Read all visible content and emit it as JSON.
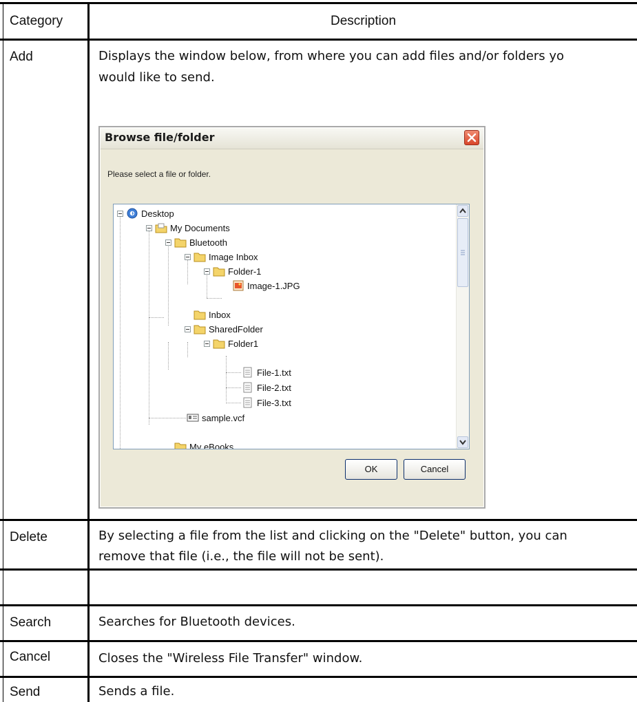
{
  "table": {
    "header": {
      "category": "Category",
      "description": "Description"
    },
    "rows": [
      {
        "category": "Add",
        "description_lines": [
          "Displays the window below, from where you can add files and/or folders yo",
          "would like to send."
        ]
      },
      {
        "category": "Delete",
        "description_lines": [
          "By selecting a file from the list and clicking on the \"Delete\" button, you can",
          "remove that file (i.e., the file will not be sent)."
        ]
      },
      {
        "category": "Search",
        "description": "Searches for Bluetooth devices."
      },
      {
        "category": "Cancel",
        "description": "Closes the \"Wireless File Transfer\" window."
      },
      {
        "category": "Send",
        "description": "Sends a file."
      }
    ]
  },
  "dialog": {
    "title": "Browse file/folder",
    "prompt": "Please select a file or folder.",
    "tree": [
      {
        "label": "Desktop",
        "icon": "desktop-icon"
      },
      {
        "label": "My Documents",
        "icon": "my-documents-folder-icon"
      },
      {
        "label": "Bluetooth",
        "icon": "folder-icon"
      },
      {
        "label": "Image Inbox",
        "icon": "folder-icon"
      },
      {
        "label": "Folder-1",
        "icon": "folder-icon"
      },
      {
        "label": "Image-1.JPG",
        "icon": "image-file-icon"
      },
      {
        "label": "Inbox",
        "icon": "folder-icon"
      },
      {
        "label": "SharedFolder",
        "icon": "folder-icon"
      },
      {
        "label": "Folder1",
        "icon": "folder-icon"
      },
      {
        "label": "File-1.txt",
        "icon": "text-file-icon"
      },
      {
        "label": "File-2.txt",
        "icon": "text-file-icon"
      },
      {
        "label": "File-3.txt",
        "icon": "text-file-icon"
      },
      {
        "label": "sample.vcf",
        "icon": "vcard-file-icon"
      },
      {
        "label": "My eBooks",
        "icon": "folder-icon"
      }
    ],
    "ok_label": "OK",
    "cancel_label": "Cancel",
    "colors": {
      "folder": "#f4d46a",
      "close_button": "#d8462a",
      "button_border": "#0b2e6b"
    }
  }
}
